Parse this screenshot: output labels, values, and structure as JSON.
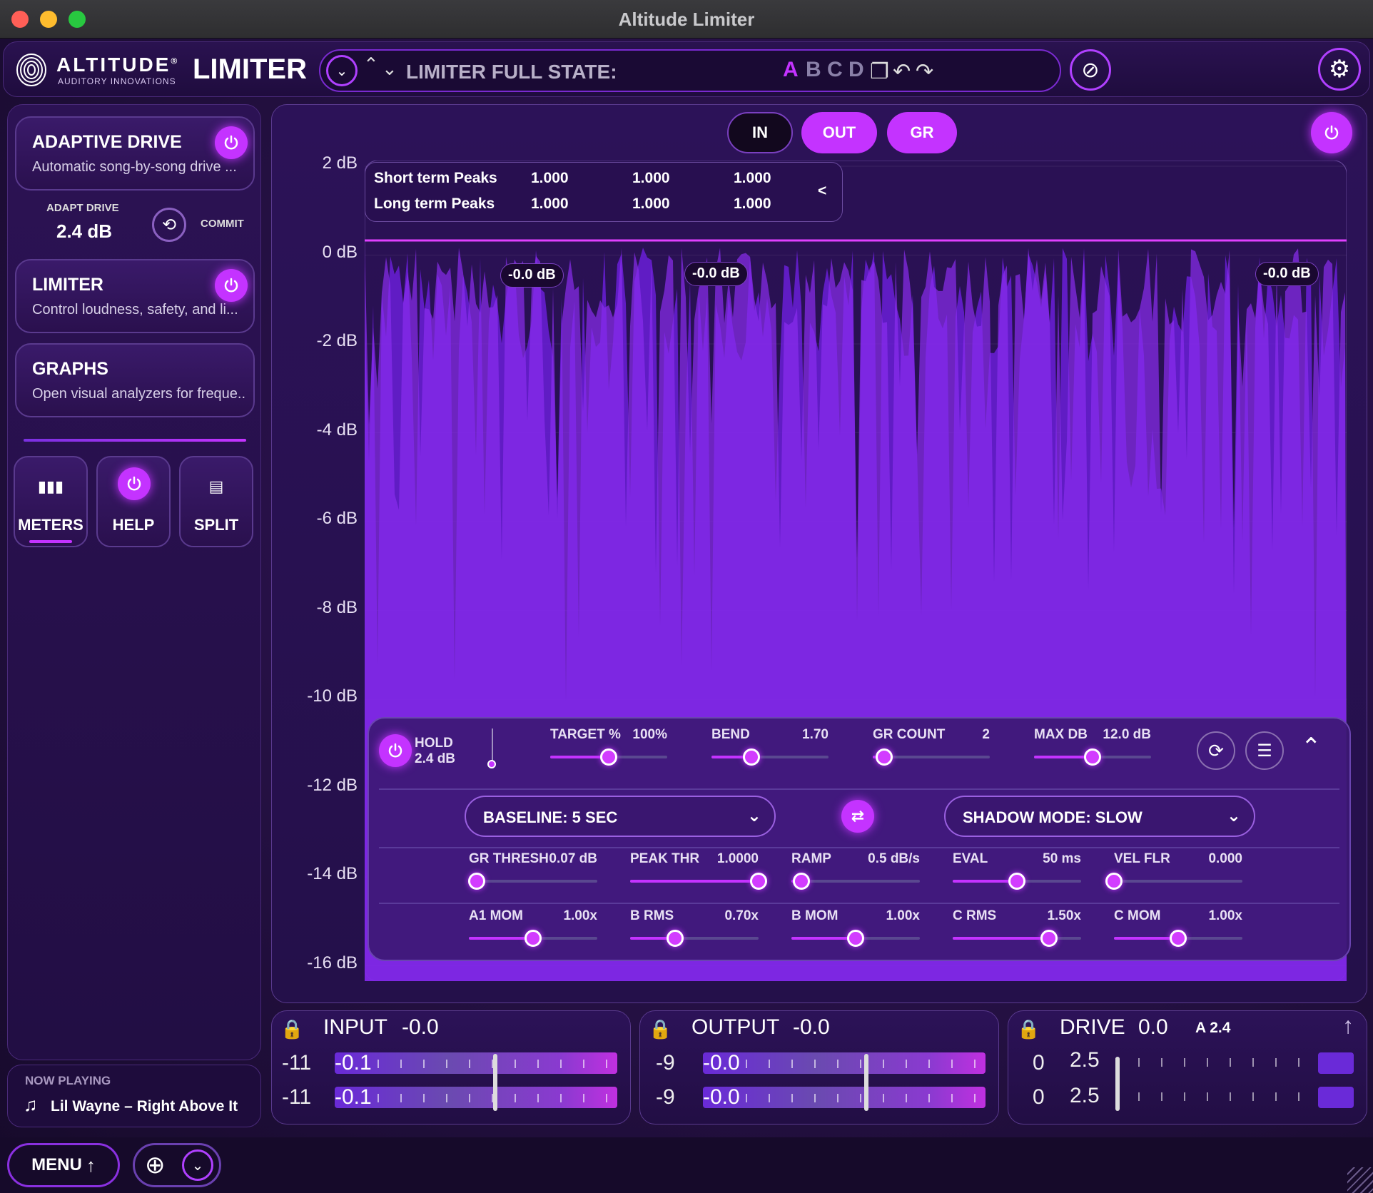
{
  "window": {
    "title": "Altitude Limiter"
  },
  "header": {
    "brand": "ALTITUDE",
    "brand_reg": "®",
    "brand_sub": "AUDITORY INNOVATIONS",
    "product": "LIMITER",
    "preset_label": "LIMITER FULL STATE:",
    "slots": [
      "A",
      "B",
      "C",
      "D"
    ],
    "active_slot": "A",
    "icons": [
      "chevron-down-icon",
      "arrow-up-icon",
      "arrow-down-icon",
      "copy-icon",
      "undo-icon",
      "redo-icon",
      "bypass-icon",
      "gear-icon"
    ]
  },
  "sidebar": {
    "adaptive": {
      "title": "ADAPTIVE DRIVE",
      "subtitle": "Automatic song-by-song drive ..."
    },
    "adapt_drive_label": "ADAPT DRIVE",
    "adapt_drive_value": "2.4 dB",
    "commit_label": "COMMIT",
    "limiter": {
      "title": "LIMITER",
      "subtitle": "Control loudness, safety, and li..."
    },
    "graphs": {
      "title": "GRAPHS",
      "subtitle": "Open visual analyzers for freque..."
    },
    "tiles": [
      "METERS",
      "HELP",
      "SPLIT"
    ],
    "now_playing_label": "NOW PLAYING",
    "now_playing_track": "Lil Wayne – Right Above It"
  },
  "graph": {
    "modes": [
      "IN",
      "OUT",
      "GR"
    ],
    "y_labels": [
      "2 dB",
      "0 dB",
      "-2 dB",
      "-4 dB",
      "-6 dB",
      "-8 dB",
      "-10 dB",
      "-12 dB",
      "-14 dB",
      "-16 dB"
    ],
    "peaks": {
      "short_label": "Short term Peaks",
      "long_label": "Long term Peaks",
      "short_values": [
        "1.000",
        "1.000",
        "1.000"
      ],
      "long_values": [
        "1.000",
        "1.000",
        "1.000"
      ],
      "collapse": "<"
    },
    "markers": [
      "-0.0 dB",
      "-0.0 dB",
      "-0.0 dB"
    ]
  },
  "controls": {
    "hold_label": "HOLD",
    "hold_value": "2.4 dB",
    "row1": [
      {
        "label": "TARGET %",
        "value": "100%",
        "level": 0.5
      },
      {
        "label": "BEND",
        "value": "1.70",
        "level": 0.34
      },
      {
        "label": "GR COUNT",
        "value": "2",
        "level": 0.1
      },
      {
        "label": "MAX DB",
        "value": "12.0 dB",
        "level": 0.5
      }
    ],
    "baseline": "BASELINE: 5 SEC",
    "shadow_mode": "SHADOW MODE: SLOW",
    "row2": [
      {
        "label": "GR THRESH",
        "value": "0.07 dB",
        "level": 0.06
      },
      {
        "label": "PEAK THR",
        "value": "1.0000",
        "level": 1.0
      },
      {
        "label": "RAMP",
        "value": "0.5 dB/s",
        "level": 0.08
      },
      {
        "label": "EVAL",
        "value": "50 ms",
        "level": 0.5
      },
      {
        "label": "VEL FLR",
        "value": "0.000",
        "level": 0.0
      }
    ],
    "row3": [
      {
        "label": "A1 MOM",
        "value": "1.00x",
        "level": 0.5
      },
      {
        "label": "B RMS",
        "value": "0.70x",
        "level": 0.35
      },
      {
        "label": "B MOM",
        "value": "1.00x",
        "level": 0.5
      },
      {
        "label": "C RMS",
        "value": "1.50x",
        "level": 0.75
      },
      {
        "label": "C MOM",
        "value": "1.00x",
        "level": 0.5
      }
    ]
  },
  "meters": {
    "input": {
      "title": "INPUT",
      "value": "-0.0",
      "rows": [
        {
          "lab": "-11",
          "bar": "-0.1"
        },
        {
          "lab": "-11",
          "bar": "-0.1"
        }
      ]
    },
    "output": {
      "title": "OUTPUT",
      "value": "-0.0",
      "rows": [
        {
          "lab": "-9",
          "bar": "-0.0"
        },
        {
          "lab": "-9",
          "bar": "-0.0"
        }
      ]
    },
    "drive": {
      "title": "DRIVE",
      "value": "0.0",
      "extra": "A 2.4",
      "rows": [
        {
          "lab": "0",
          "val": "2.5"
        },
        {
          "lab": "0",
          "val": "2.5"
        }
      ]
    }
  },
  "footer": {
    "menu": "MENU"
  },
  "colors": {
    "accent": "#c433ff",
    "bg": "#241042"
  }
}
